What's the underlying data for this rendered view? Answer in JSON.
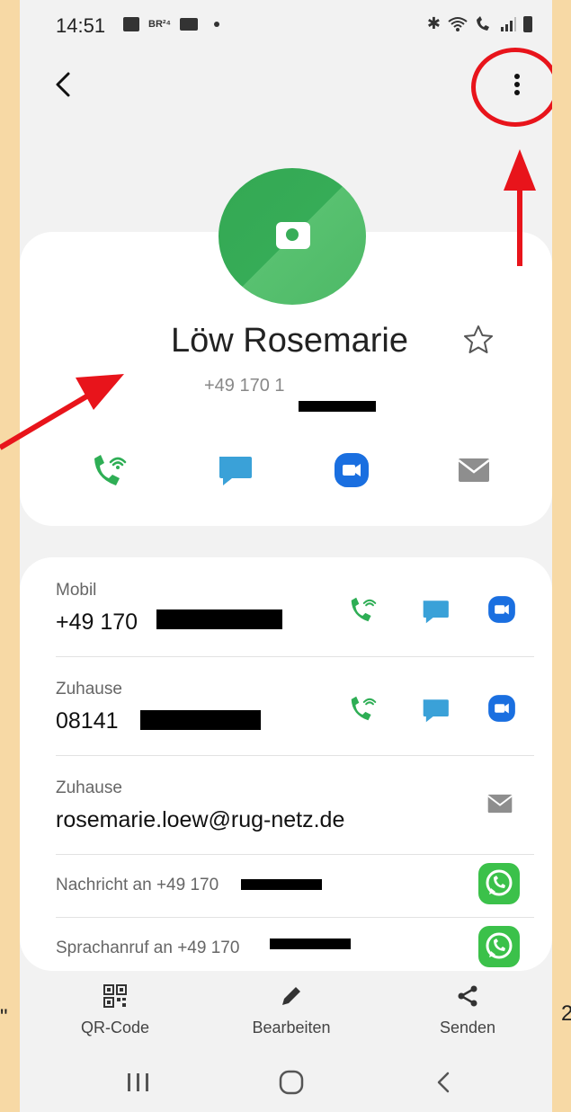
{
  "status_bar": {
    "time": "14:51",
    "carrier_badge": "BR²⁴"
  },
  "contact": {
    "name": "Löw Rosemarie",
    "phone_visible": "+49 170 1"
  },
  "details": {
    "mobile_label": "Mobil",
    "mobile_number": "+49 170",
    "home_label": "Zuhause",
    "home_number": "08141",
    "email_label": "Zuhause",
    "email": "rosemarie.loew@rug-netz.de",
    "whatsapp_message": "Nachricht an +49 170",
    "whatsapp_call": "Sprachanruf an +49 170"
  },
  "bottom_bar": {
    "qr_label": "QR-Code",
    "edit_label": "Bearbeiten",
    "share_label": "Senden"
  },
  "edge_text": {
    "left": "\"",
    "right": "2"
  },
  "colors": {
    "page_background": "#f7d9a5",
    "annotation_red": "#e8141b",
    "call_green": "#2eae55",
    "message_blue": "#3aa1d8",
    "video_blue": "#1a6fe0",
    "whatsapp_green": "#3bc14a",
    "avatar_green": "#34a853"
  },
  "icons": [
    "back-icon",
    "more-options-icon",
    "camera-icon",
    "star-icon",
    "wifi-call-icon",
    "message-icon",
    "video-call-icon",
    "email-icon",
    "whatsapp-icon",
    "qr-code-icon",
    "edit-icon",
    "share-icon"
  ]
}
